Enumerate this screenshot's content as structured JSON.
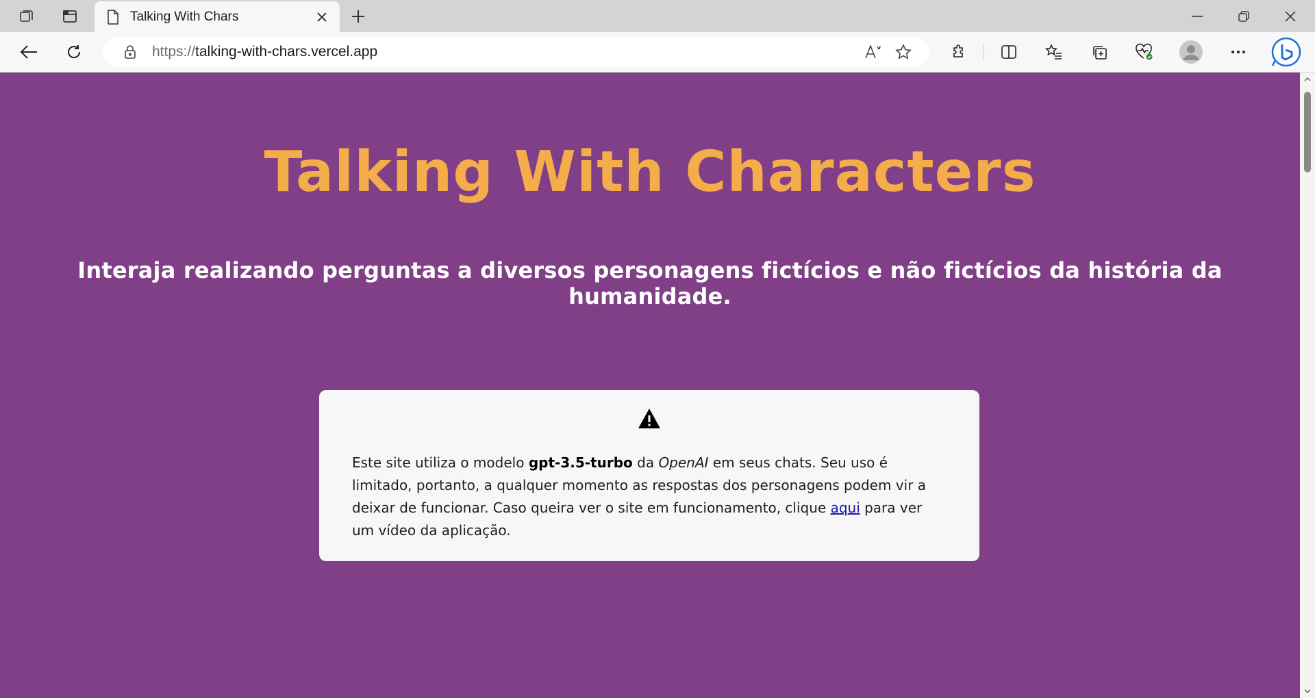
{
  "browser": {
    "tab_title": "Talking With Chars",
    "url_scheme": "https://",
    "url_host": "talking-with-chars.vercel.app",
    "icons": {
      "workspaces": "workspaces-icon",
      "vertical_tabs": "vertical-tabs-icon",
      "page": "page-icon",
      "close_tab": "close-icon",
      "new_tab": "plus-icon",
      "back": "back-arrow-icon",
      "refresh": "refresh-icon",
      "lock": "lock-icon",
      "read_aloud": "read-aloud-icon",
      "favorite": "star-icon",
      "extensions": "puzzle-icon",
      "split_screen": "split-screen-icon",
      "favorites": "favorites-list-icon",
      "collections": "collections-icon",
      "performance": "heart-pulse-icon",
      "profile": "profile-avatar-icon",
      "more": "more-icon",
      "copilot": "bing-icon"
    }
  },
  "page": {
    "title": "Talking With Characters",
    "subtitle": "Interaja realizando perguntas a diversos personagens fictícios e não fictícios da história da humanidade.",
    "notice": {
      "icon": "warning-icon",
      "text_1": "Este site utiliza o modelo ",
      "model": "gpt-3.5-turbo",
      "text_2": " da ",
      "provider": "OpenAI",
      "text_3": " em seus chats. Seu uso é limitado, portanto, a qualquer momento as respostas dos personagens podem vir a deixar de funcionar. Caso queira ver o site em funcionamento, clique ",
      "link": "aqui",
      "text_4": " para ver um vídeo da aplicação."
    }
  },
  "colors": {
    "background": "#803f86",
    "title": "#f4ad4a",
    "subtitle": "#ffffff",
    "card": "#f7f6f8",
    "link": "#1a1aa6"
  }
}
